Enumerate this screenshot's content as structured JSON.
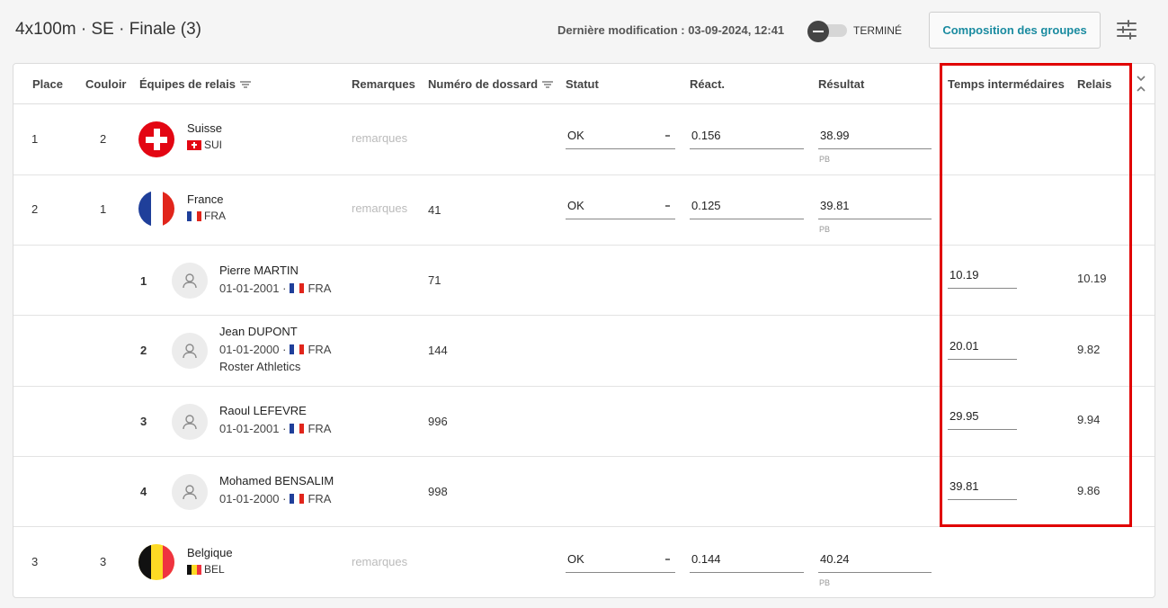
{
  "header": {
    "title": "4x100m · SE · Finale (3)",
    "last_modified": "Dernière modification : 03-09-2024, 12:41",
    "status_toggle_label": "TERMINÉ",
    "compose_button": "Composition des groupes"
  },
  "columns": {
    "place": "Place",
    "lane": "Couloir",
    "teams": "Équipes de relais",
    "remarks": "Remarques",
    "bib": "Numéro de dossard",
    "status": "Statut",
    "reaction": "Réact.",
    "result": "Résultat",
    "splits": "Temps intermédaires",
    "relay": "Relais"
  },
  "teams": [
    {
      "place": "1",
      "lane": "2",
      "name": "Suisse",
      "code": "SUI",
      "remarks_placeholder": "remarques",
      "bib": "",
      "status": "OK",
      "reaction": "0.156",
      "result": "38.99",
      "result_note": "PB"
    },
    {
      "place": "2",
      "lane": "1",
      "name": "France",
      "code": "FRA",
      "remarks_placeholder": "remarques",
      "bib": "41",
      "status": "OK",
      "reaction": "0.125",
      "result": "39.81",
      "result_note": "PB"
    },
    {
      "place": "3",
      "lane": "3",
      "name": "Belgique",
      "code": "BEL",
      "remarks_placeholder": "remarques",
      "bib": "",
      "status": "OK",
      "reaction": "0.144",
      "result": "40.24",
      "result_note": "PB"
    }
  ],
  "athletes": [
    {
      "order": "1",
      "name": "Pierre MARTIN",
      "dob": "01-01-2001 ·",
      "code": "FRA",
      "club": "",
      "bib": "71",
      "split": "10.19",
      "relay": "10.19"
    },
    {
      "order": "2",
      "name": "Jean DUPONT",
      "dob": "01-01-2000 ·",
      "code": "FRA",
      "club": "Roster Athletics",
      "bib": "144",
      "split": "20.01",
      "relay": "9.82"
    },
    {
      "order": "3",
      "name": "Raoul LEFEVRE",
      "dob": "01-01-2001 ·",
      "code": "FRA",
      "club": "",
      "bib": "996",
      "split": "29.95",
      "relay": "9.94"
    },
    {
      "order": "4",
      "name": "Mohamed BENSALIM",
      "dob": "01-01-2000 ·",
      "code": "FRA",
      "club": "",
      "bib": "998",
      "split": "39.81",
      "relay": "9.86"
    }
  ],
  "colors": {
    "accent": "#1a8ba0",
    "highlight": "#e00000"
  }
}
